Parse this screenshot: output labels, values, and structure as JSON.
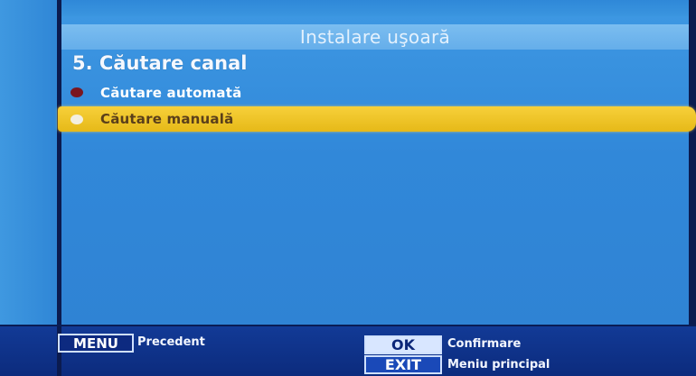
{
  "screen": {
    "title": "Instalare uşoară",
    "section_title": "5. Căutare canal"
  },
  "menu": {
    "items": [
      {
        "label": "Căutare automată",
        "bullet_color": "#7a1620",
        "selected": false
      },
      {
        "label": "Căutare manuală",
        "bullet_color": "#f3efe0",
        "selected": true
      }
    ]
  },
  "help_bar": {
    "menu_key": "MENU",
    "menu_action": "Precedent",
    "ok_key": "OK",
    "ok_action": "Confirmare",
    "exit_key": "EXIT",
    "exit_action": "Meniu principal"
  },
  "colors": {
    "panel": "#3188d9",
    "title_bar": "#6fb3ec",
    "highlight": "#f0c52a",
    "help_bar": "#0f3287"
  }
}
